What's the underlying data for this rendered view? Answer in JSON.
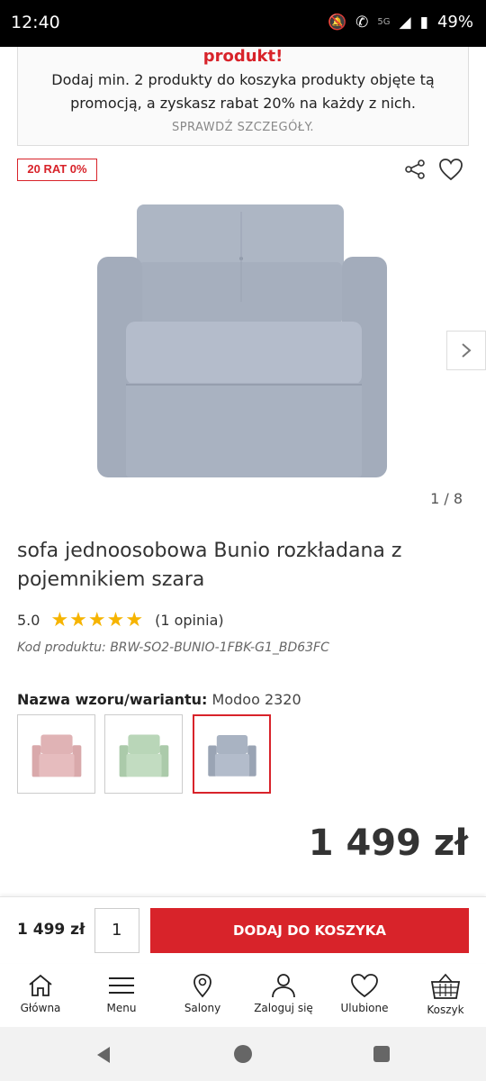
{
  "status_bar": {
    "time": "12:40",
    "battery": "49%",
    "network": "5G"
  },
  "promo": {
    "title": "produkt!",
    "text": "Dodaj min. 2 produkty do koszyka produkty objęte tą promocją, a zyskasz rabat 20% na każdy z nich.",
    "link": "SPRAWDŹ SZCZEGÓŁY."
  },
  "badge": "20 RAT 0%",
  "gallery": {
    "counter": "1 / 8",
    "image_color": "#a9b3c2"
  },
  "product": {
    "title": "sofa jednoosobowa Bunio rozkładana z pojemnikiem szara",
    "rating_value": "5.0",
    "stars": "★★★★★",
    "rating_count": "(1 opinia)",
    "code": "Kod produktu: BRW-SO2-BUNIO-1FBK-G1_BD63FC"
  },
  "variant": {
    "label": "Nazwa wzoru/wariantu:",
    "value": "Modoo 2320",
    "swatches": [
      {
        "color": "#e0b3b5",
        "selected": false
      },
      {
        "color": "#b9d6b8",
        "selected": false
      },
      {
        "color": "#a9b3c2",
        "selected": true
      }
    ]
  },
  "price": {
    "main": "1 499 zł"
  },
  "sticky": {
    "price": "1 499 zł",
    "quantity": "1",
    "add_to_cart": "DODAJ DO KOSZYKA"
  },
  "nav": [
    {
      "label": "Główna",
      "icon": "home-icon"
    },
    {
      "label": "Menu",
      "icon": "menu-icon"
    },
    {
      "label": "Salony",
      "icon": "map-pin-icon"
    },
    {
      "label": "Zaloguj się",
      "icon": "user-icon"
    },
    {
      "label": "Ulubione",
      "icon": "heart-icon"
    },
    {
      "label": "Koszyk",
      "icon": "basket-icon"
    }
  ],
  "colors": {
    "accent": "#d8232a",
    "star": "#f6b400"
  }
}
